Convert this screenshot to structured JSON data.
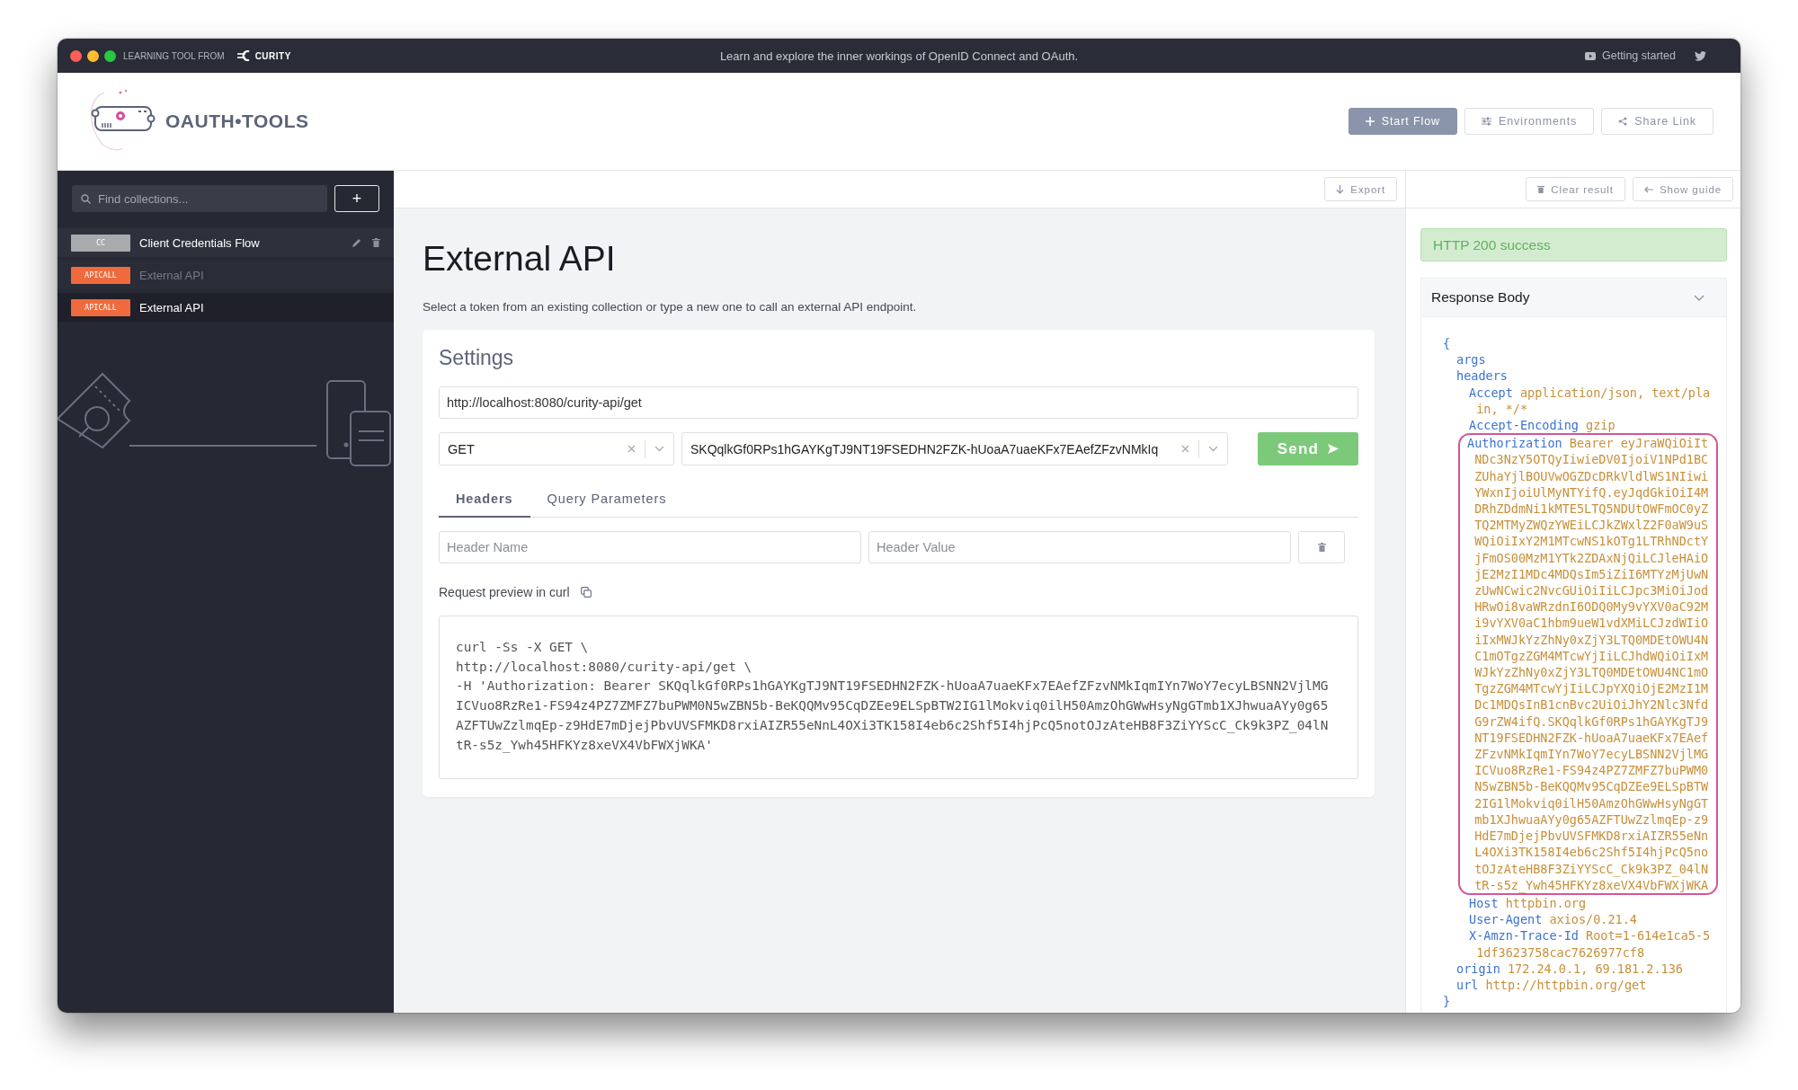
{
  "title_bar": {
    "tagline": "LEARNING TOOL FROM",
    "brand": "CURITY",
    "message": "Learn and explore the inner workings of OpenID Connect and OAuth.",
    "help_link": "Getting started"
  },
  "header": {
    "logo_text": "OAUTH•TOOLS",
    "buttons": [
      {
        "label": "Start Flow",
        "kind": "primary"
      },
      {
        "label": "Environments",
        "kind": "environments"
      },
      {
        "label": "Share Link",
        "kind": "share"
      }
    ]
  },
  "sidebar": {
    "search": {
      "placeholder": "Find collections..."
    },
    "add_button": "+",
    "items": [
      {
        "tag": "CC",
        "color": "#a9aaae",
        "label": "Client Credentials Flow",
        "selected": false,
        "dimmed": false,
        "hovered": true
      },
      {
        "tag": "APICALL",
        "color": "#ef6a3c",
        "label": "External API",
        "selected": false,
        "dimmed": true,
        "hovered": false
      },
      {
        "tag": "APICALL",
        "color": "#ef6a3c",
        "label": "External API",
        "selected": true,
        "dimmed": false,
        "hovered": false
      }
    ]
  },
  "main": {
    "toolbar_button": "Export",
    "title": "External API",
    "description": "Select a token from an existing collection or type a new one to call an external API endpoint.",
    "settings": {
      "heading": "Settings",
      "url": "http://localhost:8080/curity-api/get",
      "method": "GET",
      "token": "SKQqlkGf0RPs1hGAYKgTJ9NT19FSEDHN2FZK-hUoaA7uaeKFx7EAefZFzvNMkIq",
      "send_button": "Send",
      "tabs": [
        {
          "label": "Headers",
          "selected": true
        },
        {
          "label": "Query Parameters",
          "selected": false
        }
      ],
      "header_name": {
        "placeholder": "Header Name"
      },
      "header_value": {
        "placeholder": "Header Value"
      },
      "preview_label": "Request preview in curl",
      "curl_lines": [
        "curl -Ss -X GET \\",
        "http://localhost:8080/curity-api/get \\",
        "-H 'Authorization: Bearer SKQqlkGf0RPs1hGAYKgTJ9NT19FSEDHN2FZK-hUoaA7uaeKFx7EAefZFzvNMkIqmIYn7WoY7ecyLBSNN2VjlMGICVuo8RzRe1-FS94z4PZ7ZMFZ7buPWM0N5wZBN5b-BeKQQMv95CqDZEe9ELSpBTW2IG1lMokviq0ilH50AmzOhGWwHsyNgGTmb1XJhwuaAYy0g65AZFTUwZzlmqEp-z9HdE7mDjejPbvUVSFMKD8rxiAIZR55eNnL4OXi3TK158I4eb6c2Shf5I4hjPcQ5notOJzAteHB8F3ZiYYScC_Ck9k3PZ_04lNtR-s5z_Ywh45HFKYz8xeVX4VbFWXjWKA'"
      ]
    }
  },
  "result": {
    "buttons": [
      {
        "label": "Clear result",
        "kind": "clear"
      },
      {
        "label": "Show guide",
        "kind": "guide"
      }
    ],
    "status": "HTTP 200 success",
    "response_body": {
      "title": "Response Body",
      "open_brace": "{",
      "close_brace": "}",
      "entries": [
        {
          "key": "args",
          "highlighted": false
        },
        {
          "key": "headers",
          "highlighted": false,
          "children": [
            {
              "key": "Accept",
              "value": "application/json, text/plain, */*",
              "highlighted": false
            },
            {
              "key": "Accept-Encoding",
              "value": "gzip",
              "highlighted": false
            },
            {
              "key": "Authorization",
              "value": "Bearer eyJraWQiOiItNDc3NzY5OTQyIiwieDV0IjoiV1NPd1BCZUhaYjlBOUVwOGZDcDRkVldlWS1NIiwiYWxnIjoiUlMyNTYifQ.eyJqdGkiOiI4MDRhZDdmNi1kMTE5LTQ5NDUtOWFmOC0yZTQ2MTMyZWQzYWEiLCJkZWxlZ2F0aW9uSWQiOiIxY2M1MTcwNS1kOTg1LTRhNDctYjFmOS00MzM1YTk2ZDAxNjQiLCJleHAiOjE2MzI1MDc4MDQsIm5iZiI6MTYzMjUwNzUwNCwic2NvcGUiOiIiLCJpc3MiOiJodHRwOi8vaWRzdnI6ODQ0My9vYXV0aC92Mi9vYXV0aC1hbm9ueW1vdXMiLCJzdWIiOiIxMWJkYzZhNy0xZjY3LTQ0MDEtOWU4NC1mOTgzZGM4MTcwYjIiLCJhdWQiOiIxMWJkYzZhNy0xZjY3LTQ0MDEtOWU4NC1mOTgzZGM4MTcwYjIiLCJpYXQiOjE2MzI1MDc1MDQsInB1cnBvc2UiOiJhY2Nlc3NfdG9rZW4ifQ.SKQqlkGf0RPs1hGAYKgTJ9NT19FSEDHN2FZK-hUoaA7uaeKFx7EAefZFzvNMkIqmIYn7WoY7ecyLBSNN2VjlMGICVuo8RzRe1-FS94z4PZ7ZMFZ7buPWM0N5wZBN5b-BeKQQMv95CqDZEe9ELSpBTW2IG1lMokviq0ilH50AmzOhGWwHsyNgGTmb1XJhwuaAYy0g65AZFTUwZzlmqEp-z9HdE7mDjejPbvUVSFMKD8rxiAIZR55eNnL4OXi3TK158I4eb6c2Shf5I4hjPcQ5notOJzAteHB8F3ZiYYScC_Ck9k3PZ_04lNtR-s5z_Ywh45HFKYz8xeVX4VbFWXjWKA",
              "highlighted": true
            },
            {
              "key": "Host",
              "value": "httpbin.org",
              "highlighted": false
            },
            {
              "key": "User-Agent",
              "value": "axios/0.21.4",
              "highlighted": false
            },
            {
              "key": "X-Amzn-Trace-Id",
              "value": "Root=1-614e1ca5-51df3623758cac7626977cf8",
              "highlighted": false
            }
          ]
        },
        {
          "key": "origin",
          "value": "172.24.0.1, 69.181.2.136",
          "highlighted": false
        },
        {
          "key": "url",
          "value": "http://httpbin.org/get",
          "highlighted": false
        }
      ]
    }
  }
}
